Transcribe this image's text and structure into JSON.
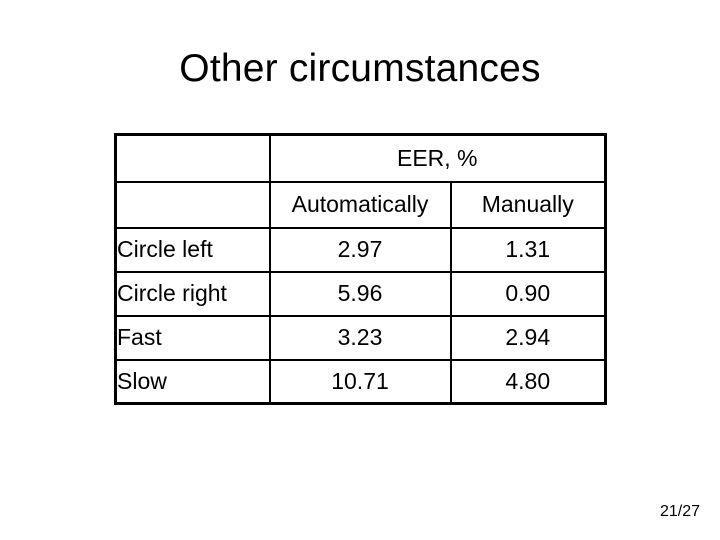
{
  "slide": {
    "title": "Other circumstances",
    "page_indicator": "21/27",
    "background_color": "#ffffff",
    "text_color": "#000000",
    "border_color": "#000000"
  },
  "table": {
    "group_header": "EER, %",
    "corner_header_top": "",
    "corner_header_sub": "",
    "column_headers": [
      "Automatically",
      "Manually"
    ],
    "rows": [
      {
        "label": "Circle left",
        "automatically": "2.97",
        "manually": "1.31"
      },
      {
        "label": "Circle right",
        "automatically": "5.96",
        "manually": "0.90"
      },
      {
        "label": "Fast",
        "automatically": "3.23",
        "manually": "2.94"
      },
      {
        "label": "Slow",
        "automatically": "10.71",
        "manually": "4.80"
      }
    ]
  }
}
